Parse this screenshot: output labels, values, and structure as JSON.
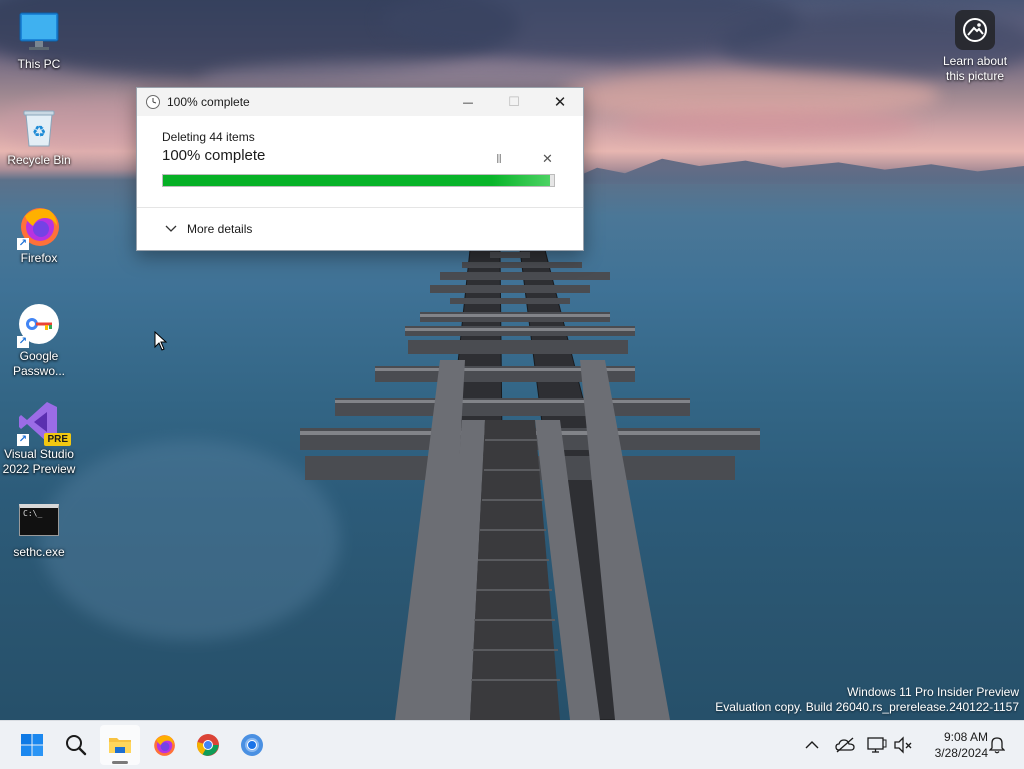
{
  "desktop": {
    "icons": [
      {
        "label": "This PC"
      },
      {
        "label": "Recycle Bin"
      },
      {
        "label": "Firefox"
      },
      {
        "label": "Google Passwo..."
      },
      {
        "label": "Visual Studio 2022 Preview",
        "badge": "PRE"
      },
      {
        "label": "sethc.exe",
        "glyph": "C:\\_"
      }
    ],
    "spotlight_label": "Learn about this picture"
  },
  "dialog": {
    "title": "100% complete",
    "operation": "Deleting 44 items",
    "percent_text": "100% complete",
    "progress_percent": 99,
    "more_details_label": "More details",
    "pause_glyph": "II",
    "cancel_glyph": "✕",
    "minimize_glyph": "—",
    "maximize_glyph": "☐",
    "close_glyph": "✕",
    "progress_color": "#06b025"
  },
  "watermark": {
    "line1": "Windows 11 Pro Insider Preview",
    "line2": "Evaluation copy. Build 26040.rs_prerelease.240122-1157"
  },
  "taskbar": {
    "apps": [
      "start-icon",
      "search-icon",
      "file-explorer-icon",
      "firefox-icon",
      "chrome-icon",
      "chrome-beta-icon"
    ],
    "active_app": "file-explorer-icon",
    "tray": [
      "chevron-up-icon",
      "onedrive-icon",
      "display-icon",
      "network-icon",
      "notification-icon"
    ],
    "time": "9:08 AM",
    "date": "3/28/2024"
  },
  "colors": {
    "accent": "#0067c0",
    "taskbar_bg": "#eef1f5"
  }
}
